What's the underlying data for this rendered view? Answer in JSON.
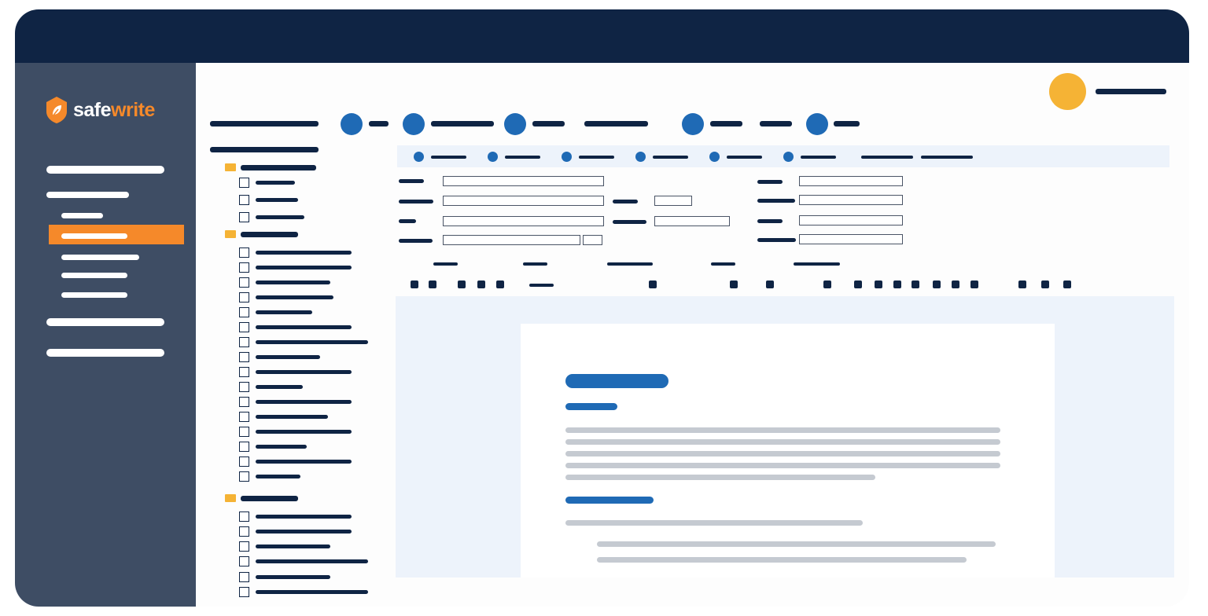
{
  "app": {
    "logo": {
      "part1": "safe",
      "part2": "write",
      "icon": "shield-leaf-icon"
    },
    "colors": {
      "topbar": "#0f2444",
      "sidebar": "#3e4d64",
      "accent": "#f5892a",
      "primary": "#1f6ab5",
      "folder": "#f5b335",
      "avatar": "#f5b335"
    }
  },
  "sidebar": {
    "items": [
      {
        "type": "item"
      },
      {
        "type": "item"
      },
      {
        "type": "subitem"
      },
      {
        "type": "subitem",
        "active": true
      },
      {
        "type": "subitem"
      },
      {
        "type": "subitem"
      },
      {
        "type": "subitem"
      },
      {
        "type": "item"
      },
      {
        "type": "item"
      }
    ]
  },
  "header": {
    "avatar_icon": "user-avatar-icon"
  },
  "document": {
    "icon_names": [
      "folder-icon",
      "checkbox-icon",
      "step-dot-icon",
      "toolbar-button-icon"
    ]
  }
}
